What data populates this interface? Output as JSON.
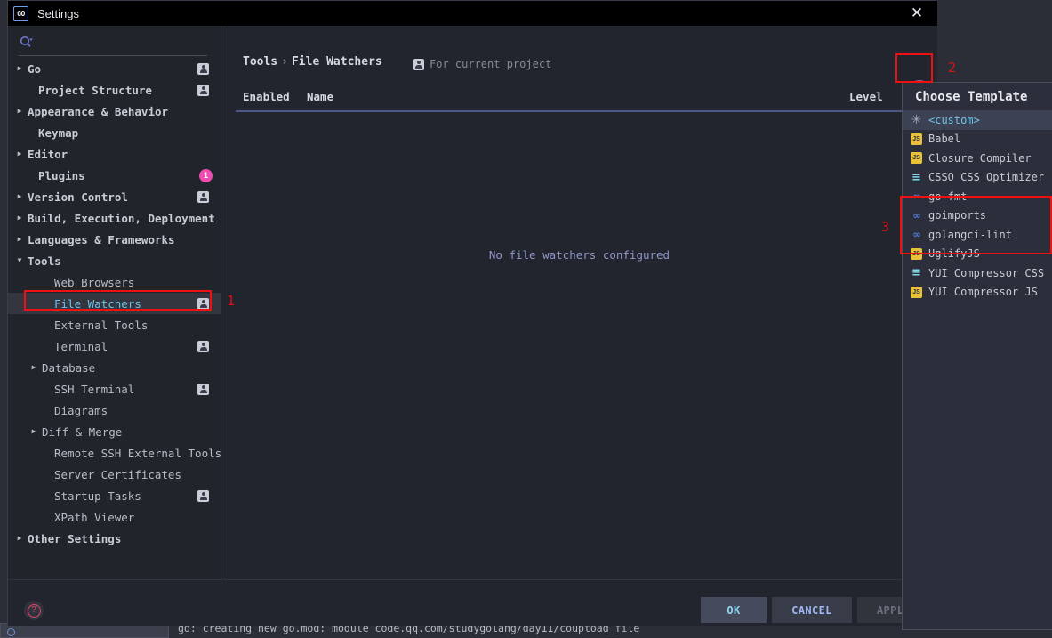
{
  "window": {
    "title": "Settings",
    "app_icon": "go-logo-icon",
    "close_label": "✕"
  },
  "sidebar": {
    "search": {
      "value": "",
      "placeholder": "",
      "icon": "search-icon"
    },
    "items": [
      {
        "label": "Go",
        "arrow": "▶",
        "indent": 22,
        "scope_icon": true,
        "bold": true,
        "selected": false
      },
      {
        "label": "Project Structure",
        "arrow": "",
        "indent": 34,
        "scope_icon": true,
        "bold": true,
        "selected": false
      },
      {
        "label": "Appearance & Behavior",
        "arrow": "▶",
        "indent": 22,
        "scope_icon": false,
        "bold": true,
        "selected": false
      },
      {
        "label": "Keymap",
        "arrow": "",
        "indent": 34,
        "scope_icon": false,
        "bold": true,
        "selected": false
      },
      {
        "label": "Editor",
        "arrow": "▶",
        "indent": 22,
        "scope_icon": false,
        "bold": true,
        "selected": false
      },
      {
        "label": "Plugins",
        "arrow": "",
        "indent": 34,
        "scope_icon": false,
        "bold": true,
        "selected": false,
        "badge": "1"
      },
      {
        "label": "Version Control",
        "arrow": "▶",
        "indent": 22,
        "scope_icon": true,
        "bold": true,
        "selected": false
      },
      {
        "label": "Build, Execution, Deployment",
        "arrow": "▶",
        "indent": 22,
        "scope_icon": false,
        "bold": true,
        "selected": false
      },
      {
        "label": "Languages & Frameworks",
        "arrow": "▶",
        "indent": 22,
        "scope_icon": false,
        "bold": true,
        "selected": false
      },
      {
        "label": "Tools",
        "arrow": "▼",
        "indent": 22,
        "scope_icon": false,
        "bold": true,
        "selected": false
      },
      {
        "label": "Web Browsers",
        "arrow": "",
        "indent": 52,
        "scope_icon": false,
        "bold": false,
        "selected": false
      },
      {
        "label": "File Watchers",
        "arrow": "",
        "indent": 52,
        "scope_icon": true,
        "bold": false,
        "selected": true
      },
      {
        "label": "External Tools",
        "arrow": "",
        "indent": 52,
        "scope_icon": false,
        "bold": false,
        "selected": false
      },
      {
        "label": "Terminal",
        "arrow": "",
        "indent": 52,
        "scope_icon": true,
        "bold": false,
        "selected": false
      },
      {
        "label": "Database",
        "arrow": "▶",
        "indent": 38,
        "scope_icon": false,
        "bold": false,
        "selected": false
      },
      {
        "label": "SSH Terminal",
        "arrow": "",
        "indent": 52,
        "scope_icon": true,
        "bold": false,
        "selected": false
      },
      {
        "label": "Diagrams",
        "arrow": "",
        "indent": 52,
        "scope_icon": false,
        "bold": false,
        "selected": false
      },
      {
        "label": "Diff & Merge",
        "arrow": "▶",
        "indent": 38,
        "scope_icon": false,
        "bold": false,
        "selected": false
      },
      {
        "label": "Remote SSH External Tools",
        "arrow": "",
        "indent": 52,
        "scope_icon": false,
        "bold": false,
        "selected": false
      },
      {
        "label": "Server Certificates",
        "arrow": "",
        "indent": 52,
        "scope_icon": false,
        "bold": false,
        "selected": false
      },
      {
        "label": "Startup Tasks",
        "arrow": "",
        "indent": 52,
        "scope_icon": true,
        "bold": false,
        "selected": false
      },
      {
        "label": "XPath Viewer",
        "arrow": "",
        "indent": 52,
        "scope_icon": false,
        "bold": false,
        "selected": false
      },
      {
        "label": "Other Settings",
        "arrow": "▶",
        "indent": 22,
        "scope_icon": false,
        "bold": true,
        "selected": false
      }
    ]
  },
  "content": {
    "breadcrumb_root": "Tools",
    "breadcrumb_sep": "›",
    "breadcrumb_leaf": "File Watchers",
    "scope_note": "For current project",
    "columns": {
      "enabled": "Enabled",
      "name": "Name",
      "level": "Level"
    },
    "empty_message": "No file watchers configured",
    "add_button_label": "+"
  },
  "footer": {
    "help_label": "?",
    "ok": "OK",
    "cancel": "CANCEL",
    "apply": "APPLY"
  },
  "popup": {
    "title": "Choose Template",
    "items": [
      {
        "label": "<custom>",
        "icon": "asterisk-icon",
        "icon_kind": "star",
        "selected": true
      },
      {
        "label": "Babel",
        "icon": "js-file-icon",
        "icon_kind": "js",
        "selected": false
      },
      {
        "label": "Closure Compiler",
        "icon": "js-file-icon",
        "icon_kind": "js",
        "selected": false
      },
      {
        "label": "CSSO CSS Optimizer",
        "icon": "css-file-icon",
        "icon_kind": "css",
        "selected": false
      },
      {
        "label": "go fmt",
        "icon": "go-logo-icon",
        "icon_kind": "go",
        "selected": false
      },
      {
        "label": "goimports",
        "icon": "go-logo-icon",
        "icon_kind": "go",
        "selected": false
      },
      {
        "label": "golangci-lint",
        "icon": "go-logo-icon",
        "icon_kind": "go",
        "selected": false
      },
      {
        "label": "UglifyJS",
        "icon": "js-file-icon",
        "icon_kind": "js",
        "selected": false
      },
      {
        "label": "YUI Compressor CSS",
        "icon": "css-file-icon",
        "icon_kind": "css",
        "selected": false
      },
      {
        "label": "YUI Compressor JS",
        "icon": "js-file-icon",
        "icon_kind": "js",
        "selected": false
      }
    ]
  },
  "annotations": {
    "color": "#ee1111",
    "markers": [
      {
        "number": "1",
        "target": "sidebar-item-file-watchers"
      },
      {
        "number": "2",
        "target": "add-file-watcher-button"
      },
      {
        "number": "3",
        "target": "go-template-group"
      }
    ]
  },
  "background": {
    "console_text": "go: creating new go.mod: module code.qq.com/studygolang/day11/couptoad_file"
  }
}
